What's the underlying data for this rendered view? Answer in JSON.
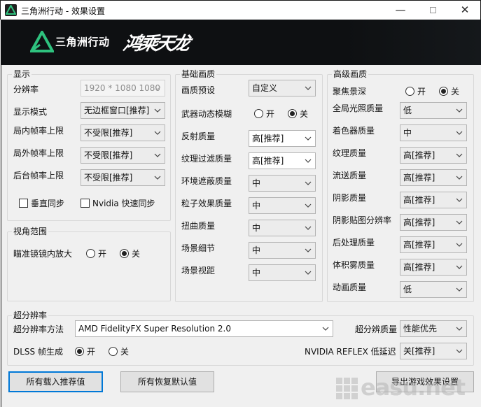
{
  "window": {
    "title": "三角洲行动 - 效果设置",
    "min_glyph": "—",
    "close_glyph": "✕"
  },
  "banner": {
    "logo_text": "三角洲行动",
    "calligraphy_text": "鸿乘天龙"
  },
  "display": {
    "group_label": "显示",
    "rows": [
      {
        "label": "分辨率",
        "value": "1920 * 1080 1080",
        "disabled": true
      },
      {
        "label": "显示模式",
        "value": "无边框窗口[推荐]"
      },
      {
        "label": "局内帧率上限",
        "value": "不受限[推荐]"
      },
      {
        "label": "局外帧率上限",
        "value": "不受限[推荐]"
      },
      {
        "label": "后台帧率上限",
        "value": "不受限[推荐]"
      }
    ],
    "vsync_label": "垂直同步",
    "nvidia_sync_label": "Nvidia 快速同步"
  },
  "fov": {
    "group_label": "视角范围",
    "scope_label": "瞄准镜镜内放大",
    "on": "开",
    "off": "关",
    "selected": "off"
  },
  "basic": {
    "group_label": "基础画质",
    "preset_label": "画质预设",
    "preset_value": "自定义",
    "motion_blur_label": "武器动态模糊",
    "on": "开",
    "off": "关",
    "motion_blur_selected": "off",
    "rows": [
      {
        "label": "反射质量",
        "value": "高[推荐]"
      },
      {
        "label": "纹理过滤质量",
        "value": "高[推荐]"
      },
      {
        "label": "环境遮蔽质量",
        "value": "中"
      },
      {
        "label": "粒子效果质量",
        "value": "中"
      },
      {
        "label": "扭曲质量",
        "value": "中"
      },
      {
        "label": "场景细节",
        "value": "中"
      },
      {
        "label": "场景视距",
        "value": "中"
      }
    ]
  },
  "advanced": {
    "group_label": "高级画质",
    "dof_label": "聚焦景深",
    "on": "开",
    "off": "关",
    "dof_selected": "off",
    "rows": [
      {
        "label": "全局光照质量",
        "value": "低"
      },
      {
        "label": "着色器质量",
        "value": "中"
      },
      {
        "label": "纹理质量",
        "value": "高[推荐]"
      },
      {
        "label": "流送质量",
        "value": "高[推荐]"
      },
      {
        "label": "阴影质量",
        "value": "高[推荐]"
      },
      {
        "label": "阴影贴图分辨率",
        "value": "高[推荐]"
      },
      {
        "label": "后处理质量",
        "value": "高[推荐]"
      },
      {
        "label": "体积雾质量",
        "value": "高[推荐]"
      },
      {
        "label": "动画质量",
        "value": "低"
      }
    ]
  },
  "superres": {
    "group_label": "超分辨率",
    "method_label": "超分辨率方法",
    "method_value": "AMD FidelityFX Super Resolution 2.0",
    "quality_label": "超分辨质量",
    "quality_value": "性能优先",
    "dlss_label": "DLSS 帧生成",
    "on": "开",
    "off": "关",
    "dlss_selected": "on",
    "reflex_label": "NVIDIA REFLEX 低延迟",
    "reflex_value": "关[推荐]"
  },
  "buttons": {
    "load_recommended": "所有载入推荐值",
    "restore_defaults": "所有恢复默认值",
    "export": "导出游戏效果设置"
  },
  "watermark": {
    "text": "easu.net"
  },
  "colors": {
    "accent": "#0078d7",
    "banner_bg": "#0e1012",
    "logo_green": "#2ec27e"
  }
}
